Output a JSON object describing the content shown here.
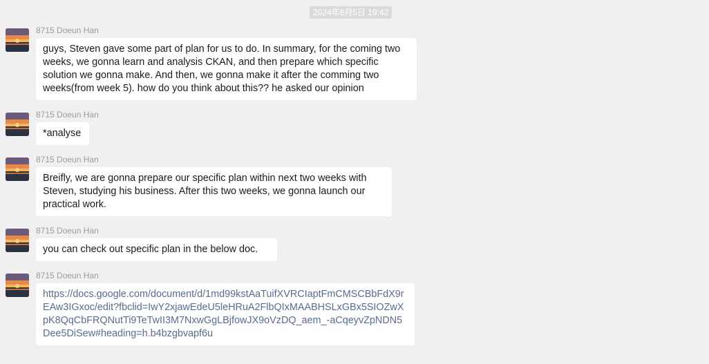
{
  "timestamp": "2024年8月5日 19:42",
  "messages": [
    {
      "sender": "8715 Doeun Han",
      "text": "guys, Steven gave some part of plan for us to do. In summary, for the coming two weeks, we gonna learn and analysis CKAN, and then prepare which specific solution we gonna make. And then, we gonna make it after the comming two weeks(from week 5). how do you think about this?? he asked our opinion"
    },
    {
      "sender": "8715 Doeun Han",
      "text": "*analyse"
    },
    {
      "sender": "8715 Doeun Han",
      "text": "Breifly, we are gonna prepare our specific plan within next two weeks with Steven, studying his business. After this two weeks, we gonna launch our practical work."
    },
    {
      "sender": "8715 Doeun Han",
      "text": "you can check out specific plan in the below doc."
    },
    {
      "sender": "8715 Doeun Han",
      "text": "https://docs.google.com/document/d/1md99kstAaTuifXVRCIaptFmCMSCBbFdX9rEAw3IGxoc/edit?fbclid=IwY2xjawEdeU5leHRuA2FlbQIxMAABHSLxGBx5SIOZwXpK8QqCbFRQNutTi9TeTwII3M7NxwGgLBjfowJX9oVzDQ_aem_-aCqeyvZpNDN5Dee5DiSew#heading=h.b4bzgbvapf6u"
    }
  ]
}
